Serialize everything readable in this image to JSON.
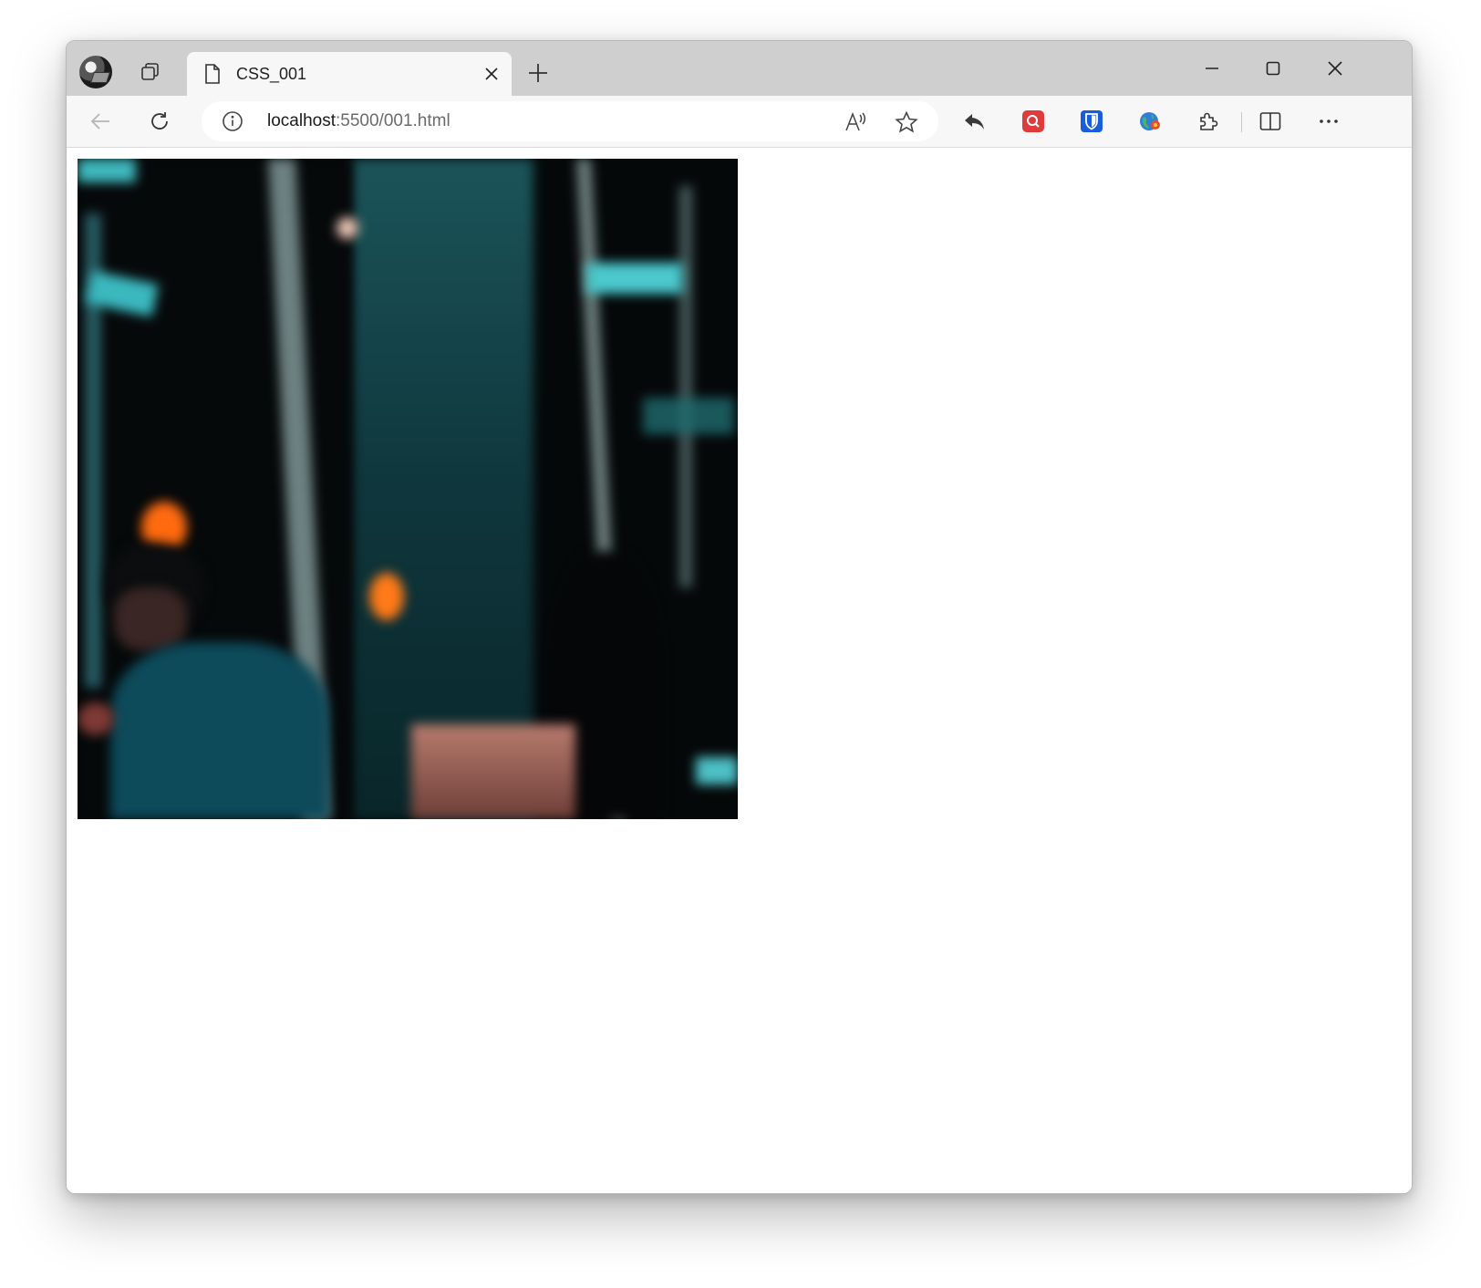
{
  "browser": {
    "tab": {
      "title": "CSS_001"
    },
    "address": {
      "host": "localhost",
      "rest": ":5500/001.html"
    },
    "icons": {
      "profile": "profile-avatar",
      "tab_actions": "tab-actions-icon",
      "page": "page-icon",
      "close_tab": "close-icon",
      "new_tab": "plus-icon",
      "minimize": "minimize-icon",
      "maximize": "maximize-icon",
      "close_window": "close-icon",
      "back": "back-arrow-icon",
      "refresh": "refresh-icon",
      "info": "info-icon",
      "read_aloud": "read-aloud-icon",
      "favorite": "star-icon",
      "share": "reply-arrow-icon",
      "ext_search": "search-extension-icon",
      "ext_bitwarden": "bitwarden-shield-icon",
      "ext_globe": "globe-extension-icon",
      "extensions": "puzzle-icon",
      "split_screen": "split-screen-icon",
      "more": "more-menu-icon"
    },
    "colors": {
      "tabstrip": "#cfcfcf",
      "toolbar": "#f7f7f7",
      "ext_search": "#e03b3b",
      "ext_bitwarden": "#175ddc"
    }
  },
  "page": {
    "image": "blurred night photo of a person in a teal shirt near a doorway with orange lights"
  }
}
